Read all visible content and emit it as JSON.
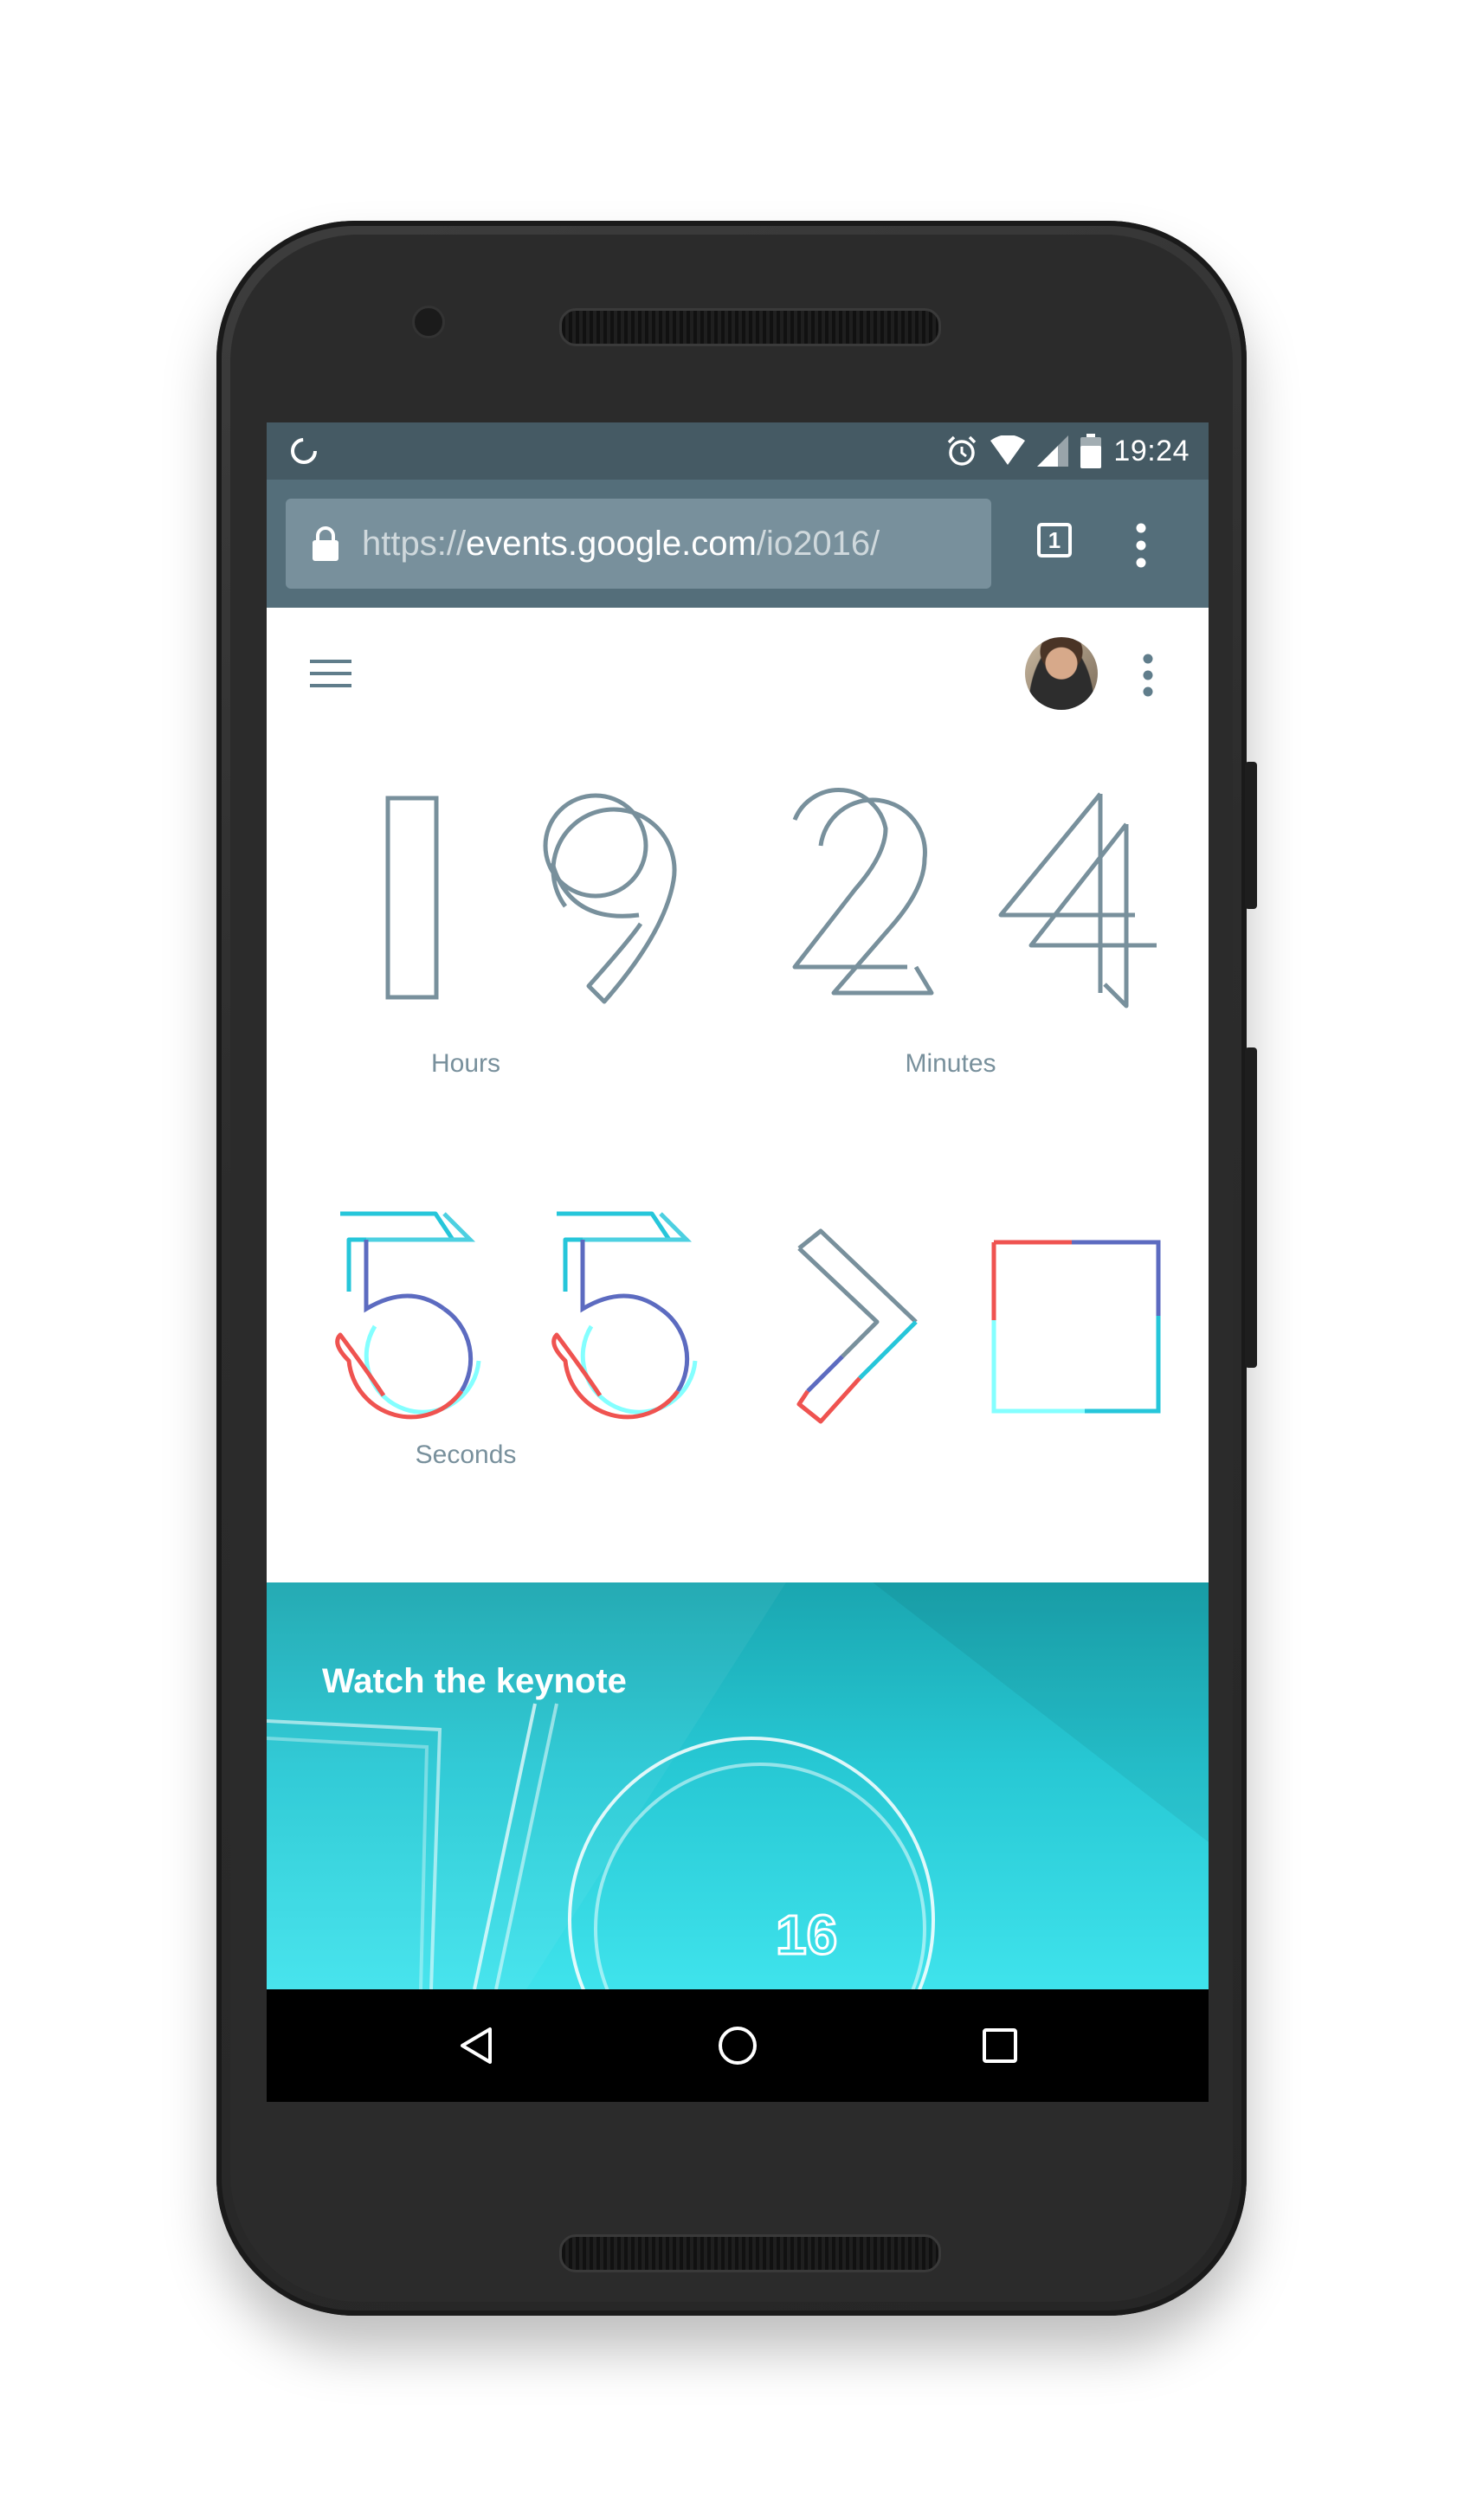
{
  "status_bar": {
    "time": "19:24"
  },
  "browser": {
    "url_scheme": "https://",
    "url_host": "events.google.com",
    "url_path": "/io2016/",
    "tab_count": "1"
  },
  "countdown": {
    "hours_digits": [
      "1",
      "9"
    ],
    "minutes_digits": [
      "2",
      "4"
    ],
    "seconds_digits": [
      "5",
      "5"
    ],
    "hours_label": "Hours",
    "minutes_label": "Minutes",
    "seconds_label": "Seconds"
  },
  "keynote": {
    "title": "Watch the keynote",
    "badge": "16"
  },
  "colors": {
    "status_bar": "#455a64",
    "toolbar": "#546e7a",
    "digit_stroke": "#78909c",
    "accent_red": "#ef5350",
    "accent_blue": "#5c6bc0",
    "accent_cyan": "#26c6da"
  }
}
